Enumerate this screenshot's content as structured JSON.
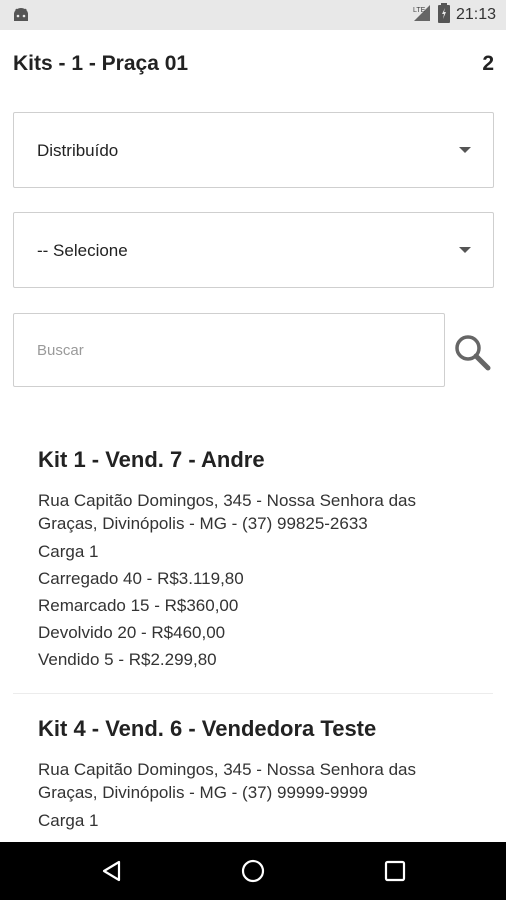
{
  "status_bar": {
    "time": "21:13",
    "signal_label": "LTE",
    "icons": [
      "android-icon",
      "lte-signal-icon",
      "battery-icon"
    ]
  },
  "header": {
    "title": "Kits - 1 - Praça 01",
    "count": "2"
  },
  "filters": {
    "status_select": {
      "value": "Distribuído"
    },
    "secondary_select": {
      "value": "-- Selecione"
    }
  },
  "search": {
    "placeholder": "Buscar",
    "value": ""
  },
  "kits": [
    {
      "title": "Kit 1 - Vend. 7 - Andre",
      "address": "Rua Capitão Domingos, 345 - Nossa Senhora das Graças, Divinópolis - MG  - (37) 99825-2633",
      "carga": "Carga 1",
      "carregado": "Carregado 40 - R$3.119,80",
      "remarcado": "Remarcado 15 - R$360,00",
      "devolvido": "Devolvido 20 - R$460,00",
      "vendido": "Vendido 5 - R$2.299,80"
    },
    {
      "title": "Kit 4 - Vend. 6 - Vendedora Teste",
      "address": "Rua Capitão Domingos, 345 - Nossa Senhora das Graças, Divinópolis - MG  - (37) 99999-9999",
      "carga": "Carga 1"
    }
  ],
  "colors": {
    "status_bar_bg": "#e8e8e8",
    "nav_bar_bg": "#000000",
    "border": "#cfcfcf",
    "text": "#222222"
  },
  "nav_icons": [
    "back-icon",
    "home-icon",
    "recent-apps-icon"
  ]
}
